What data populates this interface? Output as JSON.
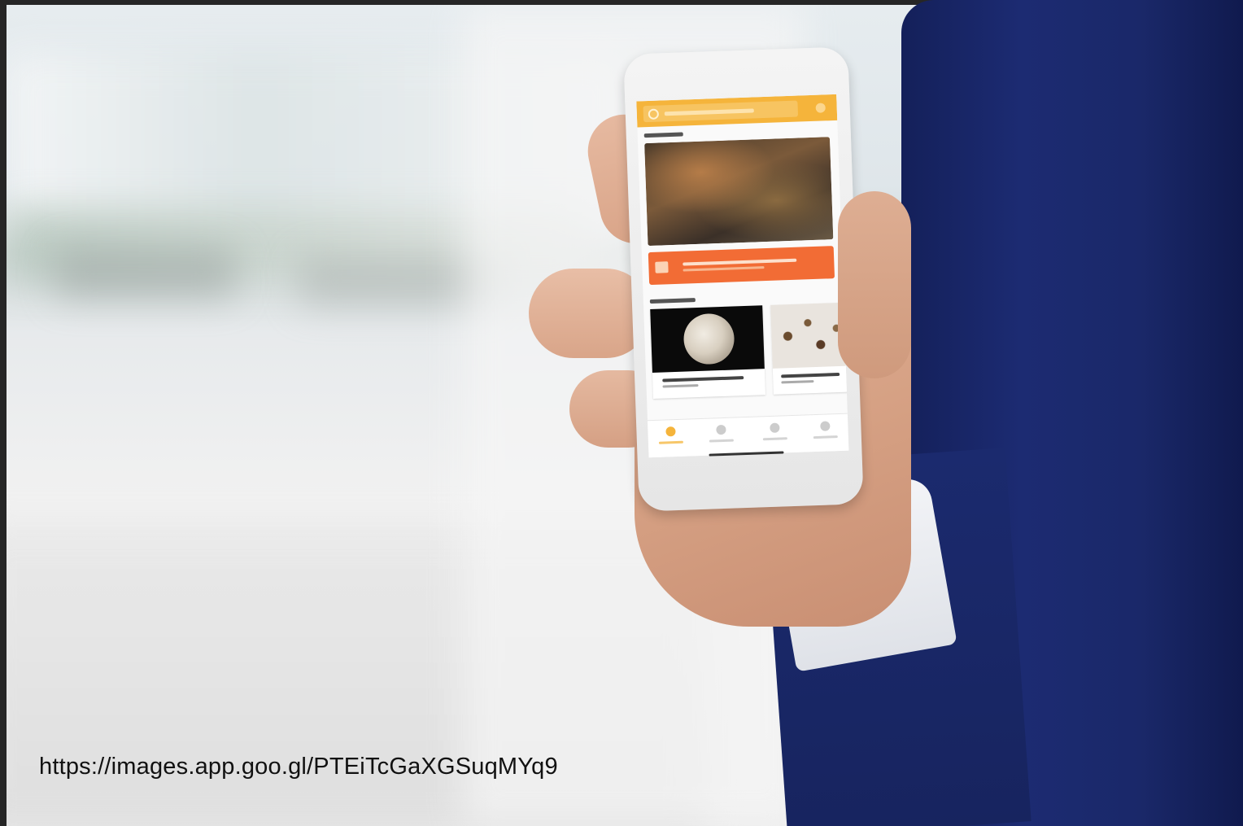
{
  "caption": {
    "url_text": "https://images.app.goo.gl/PTEiTcGaXGSuqMYq9"
  },
  "scene": {
    "colors": {
      "suit": "#1c2b72",
      "app_bar": "#f5b43b",
      "banner": "#f26c35",
      "background": "#e9ecee"
    }
  }
}
